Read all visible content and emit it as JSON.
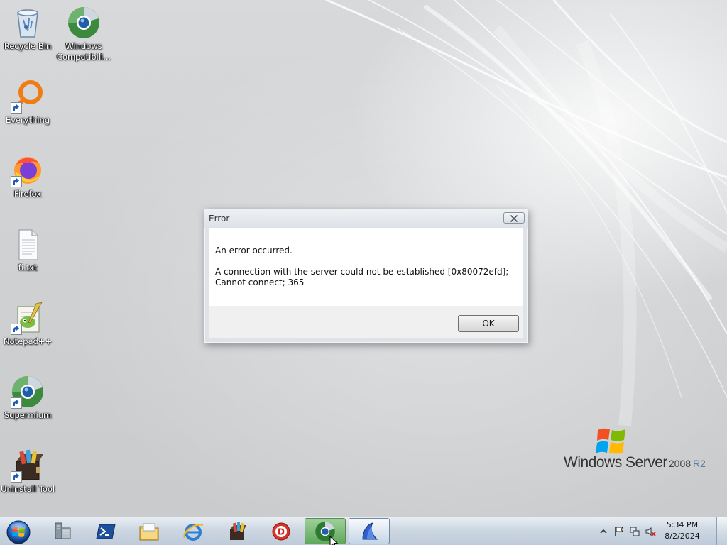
{
  "desktop": {
    "icons": [
      {
        "label": "Recycle Bin",
        "icon": "recycle-bin-icon"
      },
      {
        "label": "Windows Compatibili...",
        "icon": "windows-compatibility-icon"
      },
      {
        "label": "Everything",
        "icon": "everything-search-icon"
      },
      {
        "label": "Firefox",
        "icon": "firefox-icon"
      },
      {
        "label": "fi.txt",
        "icon": "text-file-icon"
      },
      {
        "label": "Notepad++",
        "icon": "notepad-plus-plus-icon"
      },
      {
        "label": "Supermium",
        "icon": "supermium-browser-icon"
      },
      {
        "label": "Uninstall Tool",
        "icon": "uninstall-tool-icon"
      }
    ]
  },
  "branding": {
    "name": "Windows Server",
    "version": "2008",
    "edition": "R2"
  },
  "dialog": {
    "title": "Error",
    "message_heading": "An error occurred.",
    "message_detail": "A connection with the server could not be established [0x80072efd]; Cannot connect; 365",
    "ok_label": "OK"
  },
  "taskbar": {
    "items": [
      {
        "icon": "server-manager-icon"
      },
      {
        "icon": "powershell-icon"
      },
      {
        "icon": "file-explorer-icon"
      },
      {
        "icon": "internet-explorer-icon"
      },
      {
        "icon": "archive-tool-icon"
      },
      {
        "icon": "red-d-app-icon"
      },
      {
        "icon": "supermium-browser-icon",
        "active": true
      },
      {
        "icon": "blue-sail-app-icon",
        "active": true
      }
    ],
    "tray": {
      "icons": [
        "show-hidden-icons-chevron",
        "action-center-flag-icon",
        "network-icon",
        "volume-muted-icon"
      ],
      "time": "5:34 PM",
      "date": "8/2/2024"
    }
  },
  "colors": {
    "taskbar": "#c7d3e0",
    "dialog_frame": "#dfe3e8",
    "desktop": "#cfd1d3"
  }
}
